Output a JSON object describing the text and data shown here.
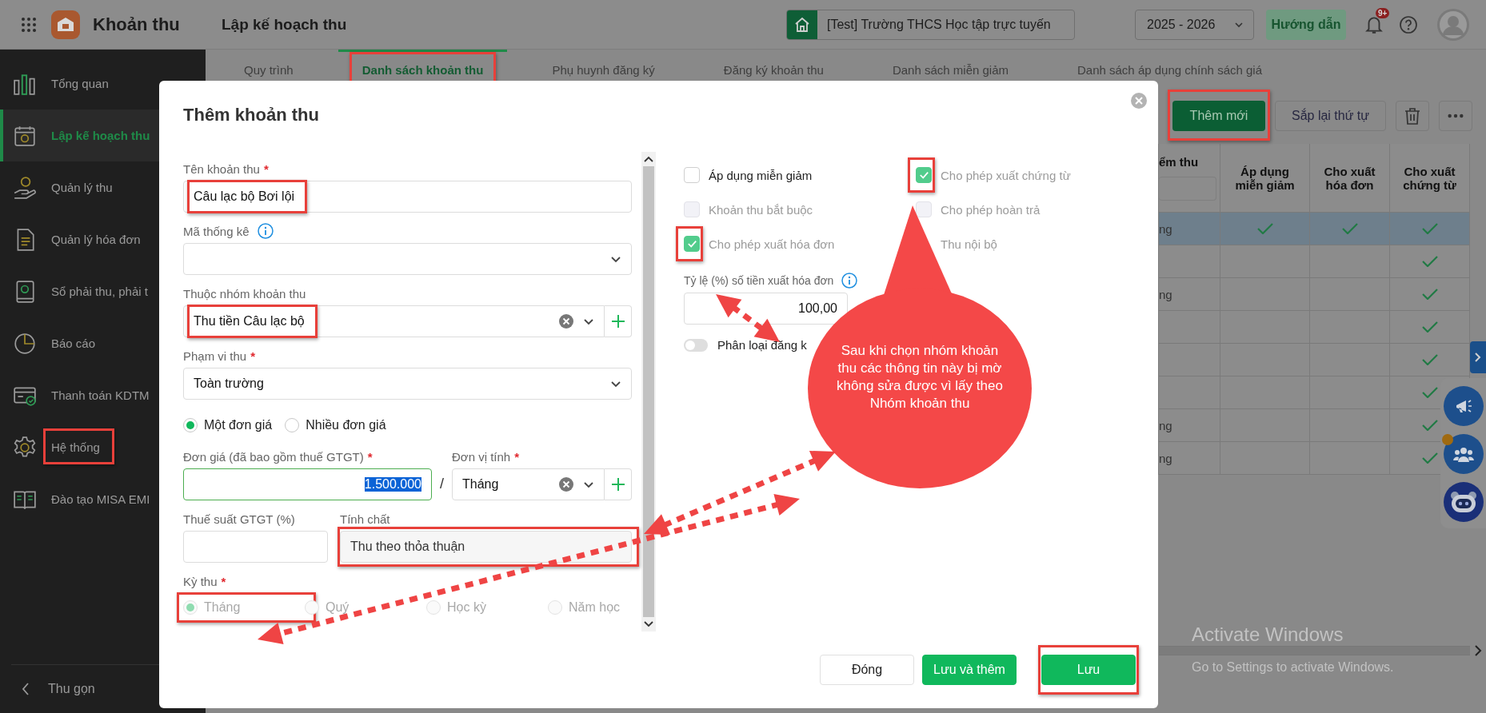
{
  "app": {
    "title": "Khoản thu"
  },
  "header": {
    "page_title": "Lập kế hoạch thu",
    "school": "[Test] Trường THCS Học tập trực tuyến",
    "year": "2025 - 2026",
    "help_button": "Hướng dẫn",
    "notification_badge": "9+"
  },
  "sidebar": {
    "items": [
      {
        "label": "Tổng quan",
        "selected": false,
        "highlighted": false
      },
      {
        "label": "Lập kế hoạch thu",
        "selected": true,
        "highlighted": false
      },
      {
        "label": "Quản lý thu",
        "selected": false,
        "highlighted": false
      },
      {
        "label": "Quản lý hóa đơn",
        "selected": false,
        "highlighted": false
      },
      {
        "label": "Sổ phải thu, phải t",
        "selected": false,
        "highlighted": false
      },
      {
        "label": "Báo cáo",
        "selected": false,
        "highlighted": false
      },
      {
        "label": "Thanh toán KDTM",
        "selected": false,
        "highlighted": false
      },
      {
        "label": "Hệ thống",
        "selected": false,
        "highlighted": true
      },
      {
        "label": "Đào tạo MISA EMI",
        "selected": false,
        "highlighted": false
      }
    ],
    "collapse": "Thu gọn"
  },
  "tabs": [
    {
      "label": "Quy trình",
      "selected": false,
      "highlighted": false
    },
    {
      "label": "Danh sách khoản thu",
      "selected": true,
      "highlighted": true
    },
    {
      "label": "Phụ huynh đăng ký",
      "selected": false,
      "highlighted": false
    },
    {
      "label": "Đăng ký khoản thu",
      "selected": false,
      "highlighted": false
    },
    {
      "label": "Danh sách miễn giảm",
      "selected": false,
      "highlighted": false
    },
    {
      "label": "Danh sách áp dụng chính sách giá",
      "selected": false,
      "highlighted": false
    }
  ],
  "toolbar": {
    "add_button": {
      "label": "Thêm mới",
      "highlighted": true
    },
    "reorder_button": "Sắp lại thứ tự"
  },
  "table": {
    "columns": [
      "ểm thu",
      "Áp dụng miễn giảm",
      "Cho xuất hóa đơn",
      "Cho xuất chứng từ"
    ],
    "rows": [
      {
        "selected": true,
        "column_1": "ng",
        "checks": [
          true,
          true,
          true
        ]
      },
      {
        "selected": false,
        "checks": [
          false,
          false,
          true
        ]
      },
      {
        "selected": false,
        "column_1": "ng",
        "checks": [
          false,
          false,
          true
        ]
      },
      {
        "selected": false,
        "checks": [
          false,
          false,
          true
        ]
      },
      {
        "selected": false,
        "checks": [
          false,
          false,
          true
        ]
      },
      {
        "selected": false,
        "checks": [
          false,
          false,
          true
        ]
      },
      {
        "selected": false,
        "column_1": "ng",
        "checks": [
          false,
          false,
          true
        ]
      },
      {
        "selected": false,
        "column_1": "ng",
        "checks": [
          false,
          false,
          true
        ]
      }
    ]
  },
  "os_notice": {
    "title": "Activate Windows",
    "subtitle": "Go to Settings to activate Windows."
  },
  "dialog": {
    "title": "Thêm khoản thu",
    "name_field": {
      "label": "Tên khoản thu",
      "required_mark": "*",
      "value": "Câu lạc bộ Bơi lội",
      "highlighted": true
    },
    "code_field": {
      "label": "Mã thống kê"
    },
    "group_field": {
      "label": "Thuộc nhóm khoản thu",
      "value": "Thu tiền Câu lạc bộ",
      "highlighted": true
    },
    "scope_field": {
      "label": "Phạm vi thu",
      "required_mark": "*",
      "value": "Toàn trường"
    },
    "price_modes": [
      {
        "label": "Một đơn giá",
        "selected": true
      },
      {
        "label": "Nhiều đơn giá",
        "selected": false
      }
    ],
    "price_field": {
      "label": "Đơn giá (đã bao gồm thuế GTGT)",
      "required_mark": "*",
      "value": "1.500.000",
      "text_selected": true
    },
    "unit_separator": "/",
    "unit_field": {
      "label": "Đơn vị tính",
      "required_mark": "*",
      "value": "Tháng"
    },
    "vat_field": {
      "label": "Thuế suất GTGT (%)"
    },
    "nature_field": {
      "label": "Tính chất",
      "value": "Thu theo thỏa thuận",
      "disabled": true,
      "highlighted": true
    },
    "period": {
      "label": "Kỳ thu",
      "required_mark": "*",
      "disabled": true,
      "options": [
        {
          "label": "Tháng",
          "selected": true,
          "highlighted": true
        },
        {
          "label": "Quý",
          "selected": false,
          "highlighted": false
        },
        {
          "label": "Học kỳ",
          "selected": false,
          "highlighted": false
        },
        {
          "label": "Năm học",
          "selected": false,
          "highlighted": false
        }
      ]
    },
    "options": [
      {
        "label": "Áp dụng miễn giảm",
        "checked": false,
        "disabled": false,
        "highlighted": false
      },
      {
        "label": "Cho phép xuất chứng từ",
        "checked": true,
        "disabled": true,
        "highlighted": true
      },
      {
        "label": "Khoản thu bắt buộc",
        "checked": false,
        "disabled": true,
        "highlighted": false
      },
      {
        "label": "Cho phép hoàn trả",
        "checked": false,
        "disabled": true,
        "highlighted": false
      },
      {
        "label": "Cho phép xuất hóa đơn",
        "checked": true,
        "disabled": true,
        "highlighted": true
      },
      {
        "label": "Thu nội bộ",
        "disabled": true
      }
    ],
    "invoice_ratio": {
      "label": "Tỷ lệ (%) số tiền xuất hóa đơn",
      "value": "100,00"
    },
    "toggle": {
      "label": "Phân loại đăng k",
      "on": false
    },
    "buttons": {
      "close": "Đóng",
      "save_and_add": "Lưu và thêm",
      "save": {
        "label": "Lưu",
        "highlighted": true
      }
    }
  },
  "callout": {
    "text": "Sau khi chọn nhóm khoản thu các thông tin này bị mờ không sửa được vì lấy theo Nhóm khoản thu"
  }
}
